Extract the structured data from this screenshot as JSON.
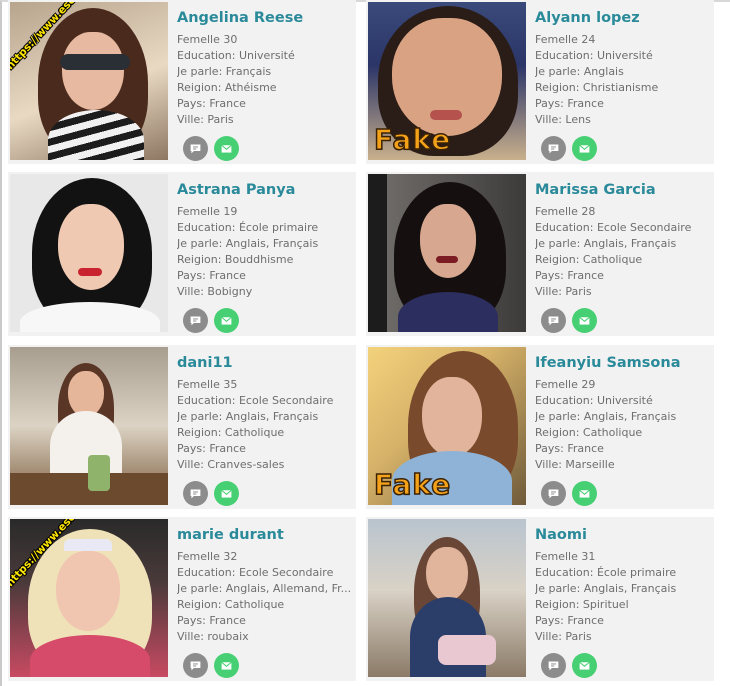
{
  "profiles": [
    {
      "name": "Angelina Reese",
      "gender_age": "Femelle 30",
      "education": "Education: Université",
      "languages": "Je parle: Français",
      "religion": "Reigion: Athéisme",
      "country": "Pays: France",
      "city": "Ville: Paris",
      "watermark": "https://www.escrocs-du-web.fr",
      "stamp": ""
    },
    {
      "name": "Alyann lopez",
      "gender_age": "Femelle 24",
      "education": "Education: Université",
      "languages": "Je parle: Anglais",
      "religion": "Reigion: Christianisme",
      "country": "Pays: France",
      "city": "Ville: Lens",
      "watermark": "",
      "stamp": "Fake"
    },
    {
      "name": "Astrana Panya",
      "gender_age": "Femelle 19",
      "education": "Education: École primaire",
      "languages": "Je parle: Anglais, Français",
      "religion": "Reigion: Bouddhisme",
      "country": "Pays: France",
      "city": "Ville: Bobigny",
      "watermark": "",
      "stamp": ""
    },
    {
      "name": "Marissa Garcia",
      "gender_age": "Femelle 28",
      "education": "Education: Ecole Secondaire",
      "languages": "Je parle: Anglais, Français",
      "religion": "Reigion: Catholique",
      "country": "Pays: France",
      "city": "Ville: Paris",
      "watermark": "",
      "stamp": ""
    },
    {
      "name": "dani11",
      "gender_age": "Femelle 35",
      "education": "Education: Ecole Secondaire",
      "languages": "Je parle: Anglais, Français",
      "religion": "Reigion: Catholique",
      "country": "Pays: France",
      "city": "Ville: Cranves-sales",
      "watermark": "",
      "stamp": ""
    },
    {
      "name": "Ifeanyiu Samsona",
      "gender_age": "Femelle 29",
      "education": "Education: Université",
      "languages": "Je parle: Anglais, Français",
      "religion": "Reigion: Catholique",
      "country": "Pays: France",
      "city": "Ville: Marseille",
      "watermark": "",
      "stamp": "Fake"
    },
    {
      "name": "marie durant",
      "gender_age": "Femelle 32",
      "education": "Education: Ecole Secondaire",
      "languages": "Je parle: Anglais, Allemand, Fr...",
      "religion": "Reigion: Catholique",
      "country": "Pays: France",
      "city": "Ville: roubaix",
      "watermark": "https://www.escrocs-du-web.fr",
      "stamp": ""
    },
    {
      "name": "Naomi",
      "gender_age": "Femelle 31",
      "education": "Education: École primaire",
      "languages": "Je parle: Anglais, Français",
      "religion": "Reigion: Spirituel",
      "country": "Pays: France",
      "city": "Ville: Paris",
      "watermark": "",
      "stamp": ""
    }
  ],
  "icons": {
    "chat": "chat-bubble-icon",
    "mail": "envelope-icon"
  },
  "colors": {
    "name": "#2a8a9a",
    "chat_button": "#8c8c8c",
    "mail_button": "#47cf73",
    "stamp": "#f4a21a",
    "watermark": "#ffe600"
  }
}
